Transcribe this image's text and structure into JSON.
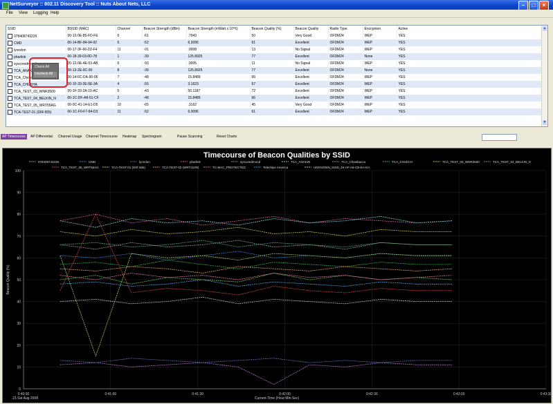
{
  "window": {
    "title": "NetSurveyor :: 802.11 Discovery Tool :: Nuts About Nets, LLC"
  },
  "menu": [
    "File",
    "View",
    "Logging",
    "Help"
  ],
  "table": {
    "columns": [
      "SSID",
      "BSSID (MAC)",
      "Channel",
      "Beacon Strength (dBm)",
      "Beacon Strength (mWatt x 10^6)",
      "Beacon Quality (%)",
      "Beacon Quality",
      "Radio Type",
      "Encryption",
      "Active"
    ],
    "rows": [
      [
        "078408743235",
        "00-12-0E-85-FD-FE",
        "6",
        "-61",
        ".7943",
        "50",
        "Very Good",
        "OFDM24",
        "WEP",
        "YES"
      ],
      [
        "CMD",
        "00-14-BF-84-94-92",
        "6",
        "-52",
        "6.3096",
        "61",
        "Excellent",
        "OFDM24",
        "WEP",
        "YES"
      ],
      [
        "lyondon",
        "00-17-3F-66-2D-F4",
        "11",
        "-91",
        ".0008",
        "13",
        "No Signal",
        "OFDM24",
        "WEP",
        "YES"
      ],
      [
        "pharlink",
        "00-18-39-03-0D-78",
        "1",
        "-39",
        "125.8925",
        "77",
        "Excellent",
        "OFDM24",
        "None",
        "YES"
      ],
      [
        "syscoredmond",
        "00-12-0E-4E-53-AB",
        "6",
        "-93",
        ".0005",
        "11",
        "No Signal",
        "OFDM24",
        "WEP",
        "YES"
      ],
      [
        "TCA_ANAKIN",
        "00-13-2E-9C-90",
        "8",
        "-39",
        "125.8925",
        "77",
        "Excellent",
        "OFDM24",
        "None",
        "YES"
      ],
      [
        "TCA_Chewbacca",
        "00-14-6C-DA-90-06",
        "7",
        "-48",
        "15.8489",
        "66",
        "Excellent",
        "OFDM24",
        "WEP",
        "YES"
      ],
      [
        "TCA_CHUKHA",
        "00-1F-33-2E-5E-3A",
        "4",
        "-55",
        "3.1623",
        "57",
        "Excellent",
        "OFDM24",
        "WEP",
        "YES"
      ],
      [
        "TCA_TEST_03_WNR3500",
        "00-1F-33-2A-10-AC",
        "5",
        "-43",
        "50.1187",
        "72",
        "Excellent",
        "OFDM24",
        "WEP",
        "YES"
      ],
      [
        "TCA_TEST_04_BELKIN_N",
        "00-1C-DF-A8-51-CF",
        "2",
        "-48",
        "15.8489",
        "66",
        "Excellent",
        "OFDM24",
        "WEP",
        "YES"
      ],
      [
        "TCA_TEST_05_WRT55AG",
        "00-0C-41-14-E1-D5",
        "10",
        "-65",
        ".3162",
        "45",
        "Very Good",
        "OFDM24",
        "WEP",
        "YES"
      ],
      [
        "TCA-TEST-01 (DIR 655)",
        "00-1C-F0-F7-84-D3",
        "11",
        "-52",
        "6.3096",
        "61",
        "Excellent",
        "OFDM24",
        "WEP",
        "YES"
      ]
    ]
  },
  "context_menu": {
    "check_all": "Check All",
    "uncheck_all": "Uncheck All"
  },
  "tabs": [
    "AP Timecourse",
    "AP Differential",
    "Channel Usage",
    "Channel Timecourse",
    "Heatmap",
    "Spectrogram",
    "Pause Scanning",
    "Reset Charts"
  ],
  "active_tab": "AP Timecourse",
  "chart_data": {
    "type": "line",
    "title": "Timecourse of Beacon Qualities by SSID",
    "xlabel": "Current-Time (Hour:Min:Sec)",
    "ylabel": "Beacon Quality (%)",
    "ylim": [
      0,
      100
    ],
    "yticks": [
      0,
      10,
      20,
      30,
      40,
      50,
      60,
      70,
      80,
      90,
      100
    ],
    "xticks": [
      "0:40:30",
      "0:41:00",
      "0:41:30",
      "0:42:00",
      "0:42:30",
      "0:43:00",
      "0:43:30"
    ],
    "date_label": "23 Sat Aug 2008",
    "grid": true,
    "legend_position": "top",
    "series": [
      {
        "name": "078408743235",
        "color": "#6abf4b",
        "values": [
          50,
          52,
          48,
          51,
          50,
          49,
          53,
          50,
          52,
          50,
          51,
          50
        ]
      },
      {
        "name": "CMD",
        "color": "#3f7fd0",
        "values": [
          61,
          60,
          62,
          59,
          61,
          63,
          60,
          61,
          60,
          62,
          61,
          61
        ]
      },
      {
        "name": "lyondon",
        "color": "#5a6fbf",
        "values": [
          13,
          12,
          14,
          13,
          12,
          13,
          14,
          12,
          13,
          12,
          13,
          13
        ]
      },
      {
        "name": "pharlink",
        "color": "#d05a9a",
        "values": [
          77,
          80,
          76,
          78,
          75,
          77,
          79,
          76,
          78,
          77,
          76,
          77
        ]
      },
      {
        "name": "syscoredmond",
        "color": "#b070c8",
        "values": [
          11,
          12,
          10,
          11,
          12,
          10,
          2,
          11,
          10,
          12,
          11,
          11
        ]
      },
      {
        "name": "TCA_ANAKIN",
        "color": "#7fcfd0",
        "values": [
          77,
          74,
          78,
          76,
          77,
          75,
          78,
          76,
          77,
          79,
          76,
          77
        ]
      },
      {
        "name": "TCA_Chewbacca",
        "color": "#9a9a9a",
        "values": [
          66,
          64,
          67,
          65,
          66,
          68,
          65,
          66,
          64,
          67,
          66,
          66
        ]
      },
      {
        "name": "TCA_CHUKHA",
        "color": "#2fb050",
        "values": [
          57,
          58,
          56,
          59,
          57,
          55,
          58,
          57,
          56,
          58,
          57,
          57
        ]
      },
      {
        "name": "TCA_TEST_03_WNR3500",
        "color": "#c8c040",
        "values": [
          72,
          70,
          73,
          71,
          72,
          74,
          71,
          72,
          70,
          73,
          72,
          72
        ]
      },
      {
        "name": "TCA_TEST_04_BELKIN_N",
        "color": "#4fa86f",
        "values": [
          66,
          67,
          65,
          66,
          68,
          65,
          67,
          66,
          65,
          67,
          66,
          66
        ]
      },
      {
        "name": "TCA_TEST_05_WRT55AG",
        "color": "#d04040",
        "values": [
          45,
          80,
          44,
          46,
          45,
          43,
          47,
          45,
          44,
          46,
          45,
          45
        ]
      },
      {
        "name": "TCA-TEST-01 (DIR 655)",
        "color": "#a0d060",
        "values": [
          61,
          15,
          62,
          60,
          61,
          59,
          62,
          61,
          60,
          62,
          61,
          61
        ]
      },
      {
        "name": "TCA-TEST-02 (WRT310N)",
        "color": "#e0a050",
        "values": [
          55,
          54,
          56,
          55,
          53,
          56,
          55,
          54,
          56,
          55,
          54,
          55
        ]
      },
      {
        "name": "TC-MAC_PROTECTED",
        "color": "#e070a0",
        "values": [
          52,
          50,
          53,
          51,
          52,
          50,
          53,
          51,
          52,
          50,
          51,
          52
        ]
      },
      {
        "name": "Telechips America",
        "color": "#50a0e0",
        "values": [
          48,
          49,
          47,
          48,
          50,
          47,
          49,
          48,
          47,
          49,
          48,
          48
        ]
      },
      {
        "name": "UNKNOWN_SSID_16-AF-A8-CB-EA-EA",
        "color": "#c0c0c0",
        "values": [
          40,
          41,
          39,
          40,
          42,
          39,
          41,
          40,
          39,
          41,
          40,
          40
        ]
      }
    ]
  }
}
